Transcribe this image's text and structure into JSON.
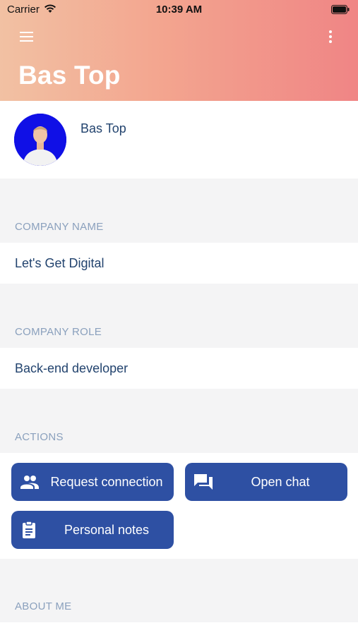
{
  "status_bar": {
    "carrier": "Carrier",
    "time": "10:39 AM"
  },
  "header": {
    "title": "Bas Top",
    "menu_icon": "hamburger-menu-icon",
    "more_icon": "vertical-dots-icon"
  },
  "profile": {
    "name": "Bas Top",
    "avatar_bg": "#1010e6"
  },
  "sections": {
    "company_name": {
      "label": "COMPANY NAME",
      "value": "Let's Get Digital"
    },
    "company_role": {
      "label": "COMPANY ROLE",
      "value": "Back-end developer"
    },
    "actions": {
      "label": "ACTIONS",
      "buttons": [
        {
          "label": "Request connection",
          "icon": "people-icon"
        },
        {
          "label": "Open chat",
          "icon": "chat-icon"
        },
        {
          "label": "Personal notes",
          "icon": "clipboard-icon"
        }
      ]
    },
    "about_me": {
      "label": "ABOUT ME"
    }
  },
  "colors": {
    "header_gradient_start": "#f2c1a3",
    "header_gradient_end": "#f08585",
    "button_bg": "#2e50a3",
    "text_dark_blue": "#22436e",
    "section_label": "#8aa0bd",
    "page_bg": "#f4f4f5"
  }
}
